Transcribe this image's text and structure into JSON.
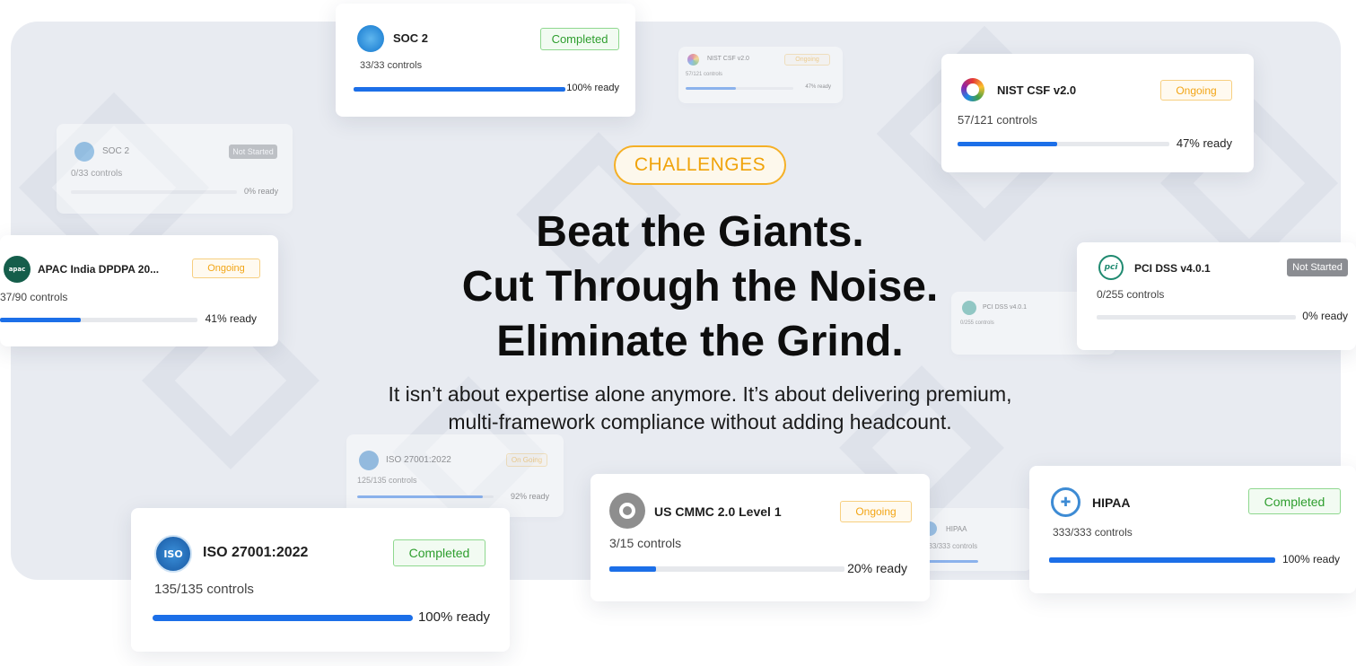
{
  "hero": {
    "tag": "CHALLENGES",
    "headline": [
      "Beat the Giants.",
      "Cut Through the Noise.",
      "Eliminate the Grind."
    ],
    "subtitle": [
      "It isn’t about expertise alone anymore. It’s about delivering premium,",
      "multi-framework compliance without adding headcount."
    ]
  },
  "colors": {
    "progress": "#1c6fe8",
    "completed": "#2e9e2e",
    "ongoing": "#f2a516",
    "not_started": "#8b8d92",
    "accent": "#f0a30a"
  },
  "cards": [
    {
      "id": "soc2-top",
      "name": "SOC 2",
      "controls": "33/33 controls",
      "status": "Completed",
      "ready": "100% ready",
      "progress": 1.0,
      "icon": "aicpa-soc-icon"
    },
    {
      "id": "nist-small",
      "name": "NIST CSF v2.0",
      "controls": "57/121 controls",
      "status": "Ongoing",
      "ready": "47% ready",
      "progress": 0.47,
      "icon": "nist-icon"
    },
    {
      "id": "nist-right",
      "name": "NIST CSF v2.0",
      "controls": "57/121 controls",
      "status": "Ongoing",
      "ready": "47% ready",
      "progress": 0.47,
      "icon": "nist-icon"
    },
    {
      "id": "soc2-faded",
      "name": "SOC 2",
      "controls": "0/33 controls",
      "status": "Not Started",
      "ready": "0% ready",
      "progress": 0.0,
      "icon": "aicpa-soc-icon"
    },
    {
      "id": "apac",
      "name": "APAC India DPDPA 20...",
      "controls": "37/90 controls",
      "status": "Ongoing",
      "ready": "41% ready",
      "progress": 0.41,
      "icon": "apac-icon",
      "icon_text": "apac"
    },
    {
      "id": "pci-faded",
      "name": "PCI DSS v4.0.1",
      "controls": "0/255 controls",
      "status": "",
      "ready": "",
      "progress": 0.0,
      "icon": "pci-icon"
    },
    {
      "id": "pci",
      "name": "PCI DSS v4.0.1",
      "controls": "0/255 controls",
      "status": "Not Started",
      "ready": "0% ready",
      "progress": 0.0,
      "icon": "pci-icon",
      "icon_text": "pci"
    },
    {
      "id": "iso-faded",
      "name": "ISO 27001:2022",
      "controls": "125/135 controls",
      "status": "On Going",
      "ready": "92% ready",
      "progress": 0.92,
      "icon": "iso-icon"
    },
    {
      "id": "iso",
      "name": "ISO 27001:2022",
      "controls": "135/135 controls",
      "status": "Completed",
      "ready": "100% ready",
      "progress": 1.0,
      "icon": "iso-icon",
      "icon_text": "ISO"
    },
    {
      "id": "cmmc",
      "name": "US CMMC 2.0 Level 1",
      "controls": "3/15 controls",
      "status": "Ongoing",
      "ready": "20% ready",
      "progress": 0.2,
      "icon": "cmmc-icon"
    },
    {
      "id": "hipaa-faded",
      "name": "HIPAA",
      "controls": "333/333 controls",
      "status": "",
      "ready": "",
      "progress": 1.0,
      "icon": "hipaa-icon"
    },
    {
      "id": "hipaa",
      "name": "HIPAA",
      "controls": "333/333 controls",
      "status": "Completed",
      "ready": "100% ready",
      "progress": 1.0,
      "icon": "hipaa-icon"
    }
  ]
}
